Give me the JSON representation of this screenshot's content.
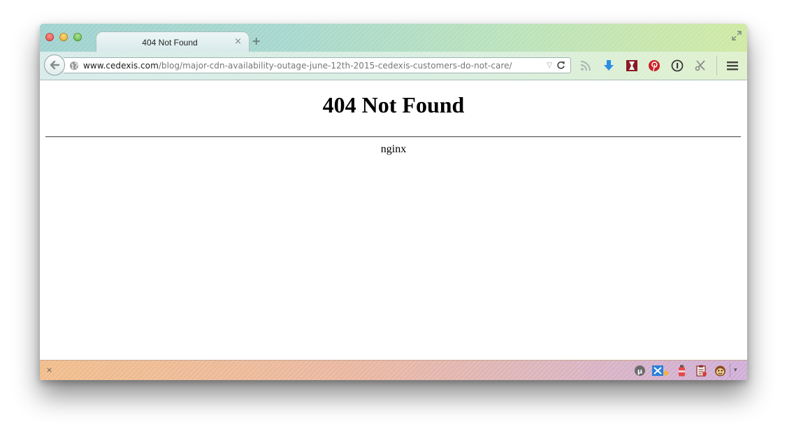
{
  "window": {
    "tab_title": "404 Not Found",
    "tab_close_glyph": "×",
    "new_tab_glyph": "+",
    "fullscreen_icon": "fullscreen-arrows-icon"
  },
  "navbar": {
    "url_host": "www.cedexis.com",
    "url_path": "/blog/major-cdn-availability-outage-june-12th-2015-cedexis-customers-do-not-care/",
    "dropmarker_glyph": "▽",
    "icons": [
      "back-arrow-icon",
      "globe-icon",
      "reload-icon",
      "rss-feed-icon",
      "download-arrow-icon",
      "bookmark-ribbon-icon",
      "pinterest-icon",
      "one-password-icon",
      "scissors-tool-icon",
      "hamburger-menu-icon"
    ]
  },
  "page": {
    "heading": "404 Not Found",
    "server": "nginx"
  },
  "addon_bar": {
    "close_glyph": "×",
    "more_glyph": "▾",
    "icons": [
      "ublock-icon",
      "network-tool-icon",
      "bottle-icon",
      "clipboard-icon",
      "monkey-face-icon"
    ]
  }
}
